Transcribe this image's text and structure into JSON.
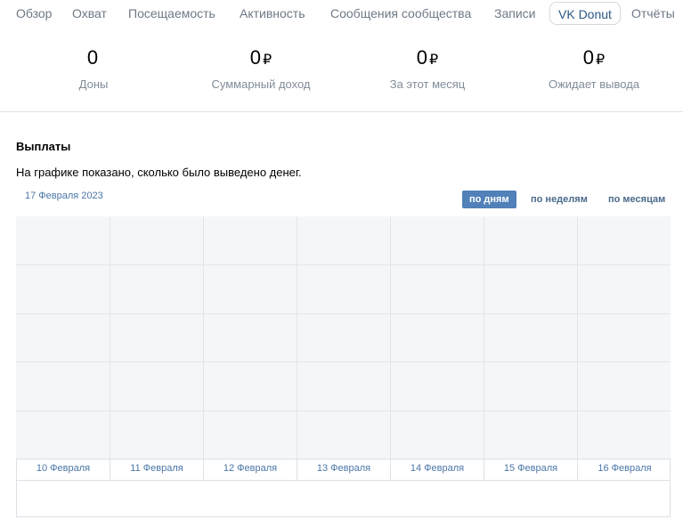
{
  "tabs": [
    {
      "label": "Обзор"
    },
    {
      "label": "Охват"
    },
    {
      "label": "Посещаемость"
    },
    {
      "label": "Активность"
    },
    {
      "label": "Сообщения сообщества"
    },
    {
      "label": "Записи"
    },
    {
      "label": "VK Donut"
    },
    {
      "label": "Отчёты"
    }
  ],
  "active_tab": "VK Donut",
  "stats": [
    {
      "value": "0",
      "currency": "",
      "label": "Доны"
    },
    {
      "value": "0",
      "currency": "₽",
      "label": "Суммарный доход"
    },
    {
      "value": "0",
      "currency": "₽",
      "label": "За этот месяц"
    },
    {
      "value": "0",
      "currency": "₽",
      "label": "Ожидает вывода"
    }
  ],
  "payouts": {
    "title": "Выплаты",
    "description": "На графике показано, сколько было выведено денег.",
    "current_date": "17 Февраля 2023",
    "periods": [
      "по дням",
      "по неделям",
      "по месяцам"
    ],
    "active_period": "по дням"
  },
  "chart_data": {
    "type": "line",
    "categories": [
      "10 Февраля",
      "11 Февраля",
      "12 Февраля",
      "13 Февраля",
      "14 Февраля",
      "15 Февраля",
      "16 Февраля"
    ],
    "series": [],
    "grid": true
  },
  "colors": {
    "accent": "#5181b8",
    "link": "#4a76a8",
    "muted": "#818c99",
    "chart_bg": "#f5f6f8"
  }
}
